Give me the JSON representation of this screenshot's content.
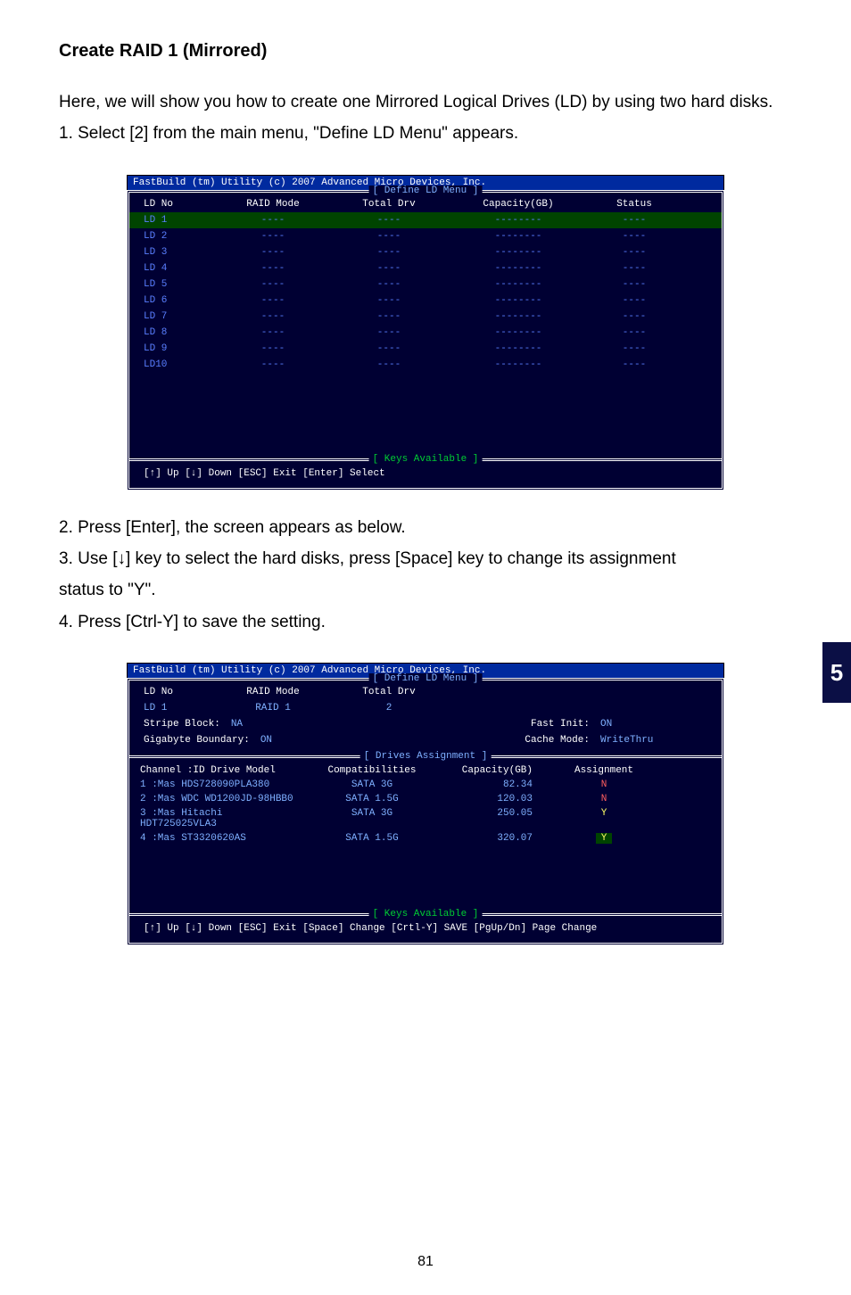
{
  "heading": "Create RAID 1 (Mirrored)",
  "intro_para": "Here, we will show you how to create one Mirrored Logical Drives (LD) by using two hard disks.",
  "step1": "1. Select [2] from the main menu, \"Define LD Menu\" appears.",
  "step2": "2. Press [Enter], the screen appears as below.",
  "step3a": "3. Use [↓] key to select the hard disks, press [Space] key to change its assignment",
  "step3b": "    status to \"Y\".",
  "step4": "4. Press [Ctrl-Y] to save the setting.",
  "side_tab": "5",
  "page_num": "81",
  "bios1": {
    "title": "FastBuild (tm) Utility (c) 2007 Advanced Micro Devices, Inc.",
    "frame": "[ Define LD Menu ]",
    "hdr_ld": "LD No",
    "hdr_mode": "RAID Mode",
    "hdr_drv": "Total Drv",
    "hdr_cap": "Capacity(GB)",
    "hdr_stat": "Status",
    "rows": [
      {
        "ld": "LD  1",
        "mode": "----",
        "drv": "----",
        "cap": "--------",
        "stat": "----",
        "sel": true
      },
      {
        "ld": "LD  2",
        "mode": "----",
        "drv": "----",
        "cap": "--------",
        "stat": "----"
      },
      {
        "ld": "LD  3",
        "mode": "----",
        "drv": "----",
        "cap": "--------",
        "stat": "----"
      },
      {
        "ld": "LD  4",
        "mode": "----",
        "drv": "----",
        "cap": "--------",
        "stat": "----"
      },
      {
        "ld": "LD  5",
        "mode": "----",
        "drv": "----",
        "cap": "--------",
        "stat": "----"
      },
      {
        "ld": "LD  6",
        "mode": "----",
        "drv": "----",
        "cap": "--------",
        "stat": "----"
      },
      {
        "ld": "LD  7",
        "mode": "----",
        "drv": "----",
        "cap": "--------",
        "stat": "----"
      },
      {
        "ld": "LD  8",
        "mode": "----",
        "drv": "----",
        "cap": "--------",
        "stat": "----"
      },
      {
        "ld": "LD  9",
        "mode": "----",
        "drv": "----",
        "cap": "--------",
        "stat": "----"
      },
      {
        "ld": "LD10",
        "mode": "----",
        "drv": "----",
        "cap": "--------",
        "stat": "----"
      }
    ],
    "keys_frame": "[ Keys Available ]",
    "keys_text": "[↑] Up    [↓] Down    [ESC] Exit    [Enter] Select"
  },
  "bios2": {
    "title": "FastBuild (tm) Utility (c) 2007 Advanced Micro Devices, Inc.",
    "frame": "[ Define LD Menu ]",
    "hdr_ld": "LD No",
    "hdr_mode": "RAID Mode",
    "hdr_drv": "Total Drv",
    "row_ld": "LD  1",
    "row_mode": "RAID 1",
    "row_drv": "2",
    "stripe_lbl": "Stripe Block:",
    "stripe_val": "NA",
    "gb_lbl": "Gigabyte Boundary:",
    "gb_val": "ON",
    "fi_lbl": "Fast Init:",
    "fi_val": "ON",
    "cm_lbl": "Cache Mode:",
    "cm_val": "WriteThru",
    "drives_frame": "[ Drives Assignment ]",
    "dhdr_ch": "Channel :ID   Drive Model",
    "dhdr_comp": "Compatibilities",
    "dhdr_cap": "Capacity(GB)",
    "dhdr_asg": "Assignment",
    "drows": [
      {
        "ch": "1 :Mas HDS728090PLA380",
        "comp": "SATA 3G",
        "cap": "82.34",
        "asg": "N",
        "cls": "n"
      },
      {
        "ch": "2 :Mas WDC WD1200JD-98HBB0",
        "comp": "SATA 1.5G",
        "cap": "120.03",
        "asg": "N",
        "cls": "n"
      },
      {
        "ch": "3 :Mas Hitachi HDT725025VLA3",
        "comp": "SATA 3G",
        "cap": "250.05",
        "asg": "Y",
        "cls": "y"
      },
      {
        "ch": "4 :Mas ST3320620AS",
        "comp": "SATA 1.5G",
        "cap": "320.07",
        "asg": "Y",
        "cls": "yhl"
      }
    ],
    "keys_frame": "[ Keys Available ]",
    "keys_text": "[↑] Up  [↓] Down  [ESC] Exit  [Space] Change  [Crtl-Y] SAVE   [PgUp/Dn] Page Change"
  }
}
